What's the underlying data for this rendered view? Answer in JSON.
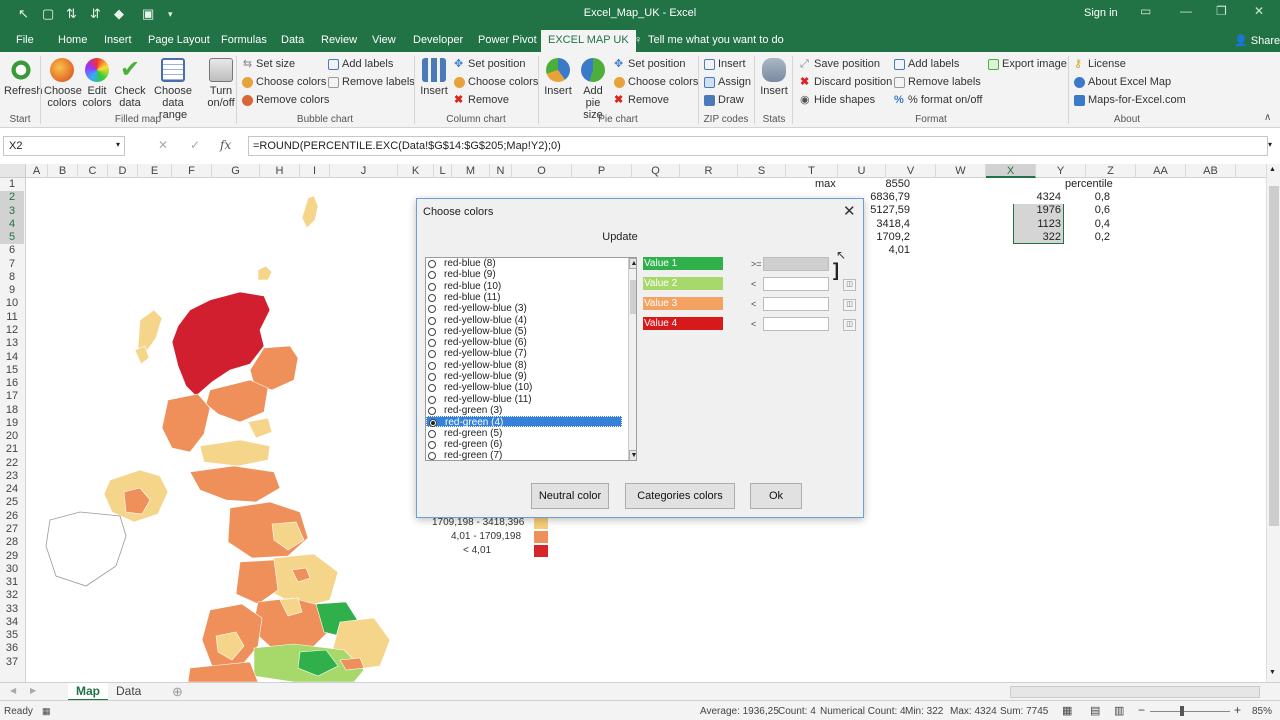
{
  "window": {
    "title": "Excel_Map_UK - Excel",
    "signin": "Sign in",
    "share": "Share"
  },
  "tabs": [
    "File",
    "Home",
    "Insert",
    "Page Layout",
    "Formulas",
    "Data",
    "Review",
    "View",
    "Developer",
    "Power Pivot",
    "EXCEL MAP UK",
    "Tell me what you want to do"
  ],
  "ribbon": {
    "refresh": "Refresh",
    "choose_colors_big": "Choose colors",
    "edit_colors": "Edit colors",
    "check_data": "Check data",
    "choose_data_range": "Choose data range",
    "turn_onoff": "Turn on/off",
    "bubble_set_size": "Set size",
    "bubble_choose_colors": "Choose colors",
    "bubble_remove_colors": "Remove colors",
    "bubble_add_labels": "Add labels",
    "bubble_remove_labels": "Remove labels",
    "column_insert": "Insert",
    "column_set_position": "Set position",
    "column_choose_colors": "Choose colors",
    "column_remove": "Remove",
    "pie_insert": "Insert",
    "pie_add_size": "Add pie size",
    "pie_set_position": "Set position",
    "pie_choose_colors": "Choose colors",
    "pie_remove": "Remove",
    "zip_insert": "Insert",
    "zip_assign": "Assign",
    "zip_draw": "Draw",
    "stats_insert": "Insert",
    "save_position": "Save position",
    "discard_position": "Discard position",
    "hide_shapes": "Hide shapes",
    "add_labels": "Add labels",
    "remove_labels": "Remove labels",
    "percent_format": "% format on/off",
    "export_image": "Export image",
    "license": "License",
    "about": "About Excel Map",
    "maps_site": "Maps-for-Excel.com",
    "groups": [
      "Start",
      "Filled map",
      "Bubble chart",
      "Column chart",
      "Pie chart",
      "ZIP codes",
      "Stats",
      "Format",
      "About"
    ]
  },
  "formula_bar": {
    "name_box": "X2",
    "formula": "=ROUND(PERCENTILE.EXC(Data!$G$14:$G$205;Map!Y2);0)"
  },
  "columns": [
    "A",
    "B",
    "C",
    "D",
    "E",
    "F",
    "G",
    "H",
    "I",
    "J",
    "K",
    "L",
    "M",
    "N",
    "O",
    "P",
    "Q",
    "R",
    "S",
    "T",
    "U",
    "V",
    "W",
    "X",
    "Y",
    "Z",
    "AA",
    "AB"
  ],
  "rows": [
    "1",
    "2",
    "3",
    "4",
    "5",
    "6",
    "7",
    "8",
    "9",
    "10",
    "11",
    "12",
    "13",
    "14",
    "15",
    "16",
    "17",
    "18",
    "19",
    "20",
    "21",
    "22",
    "23",
    "24",
    "25",
    "26",
    "27",
    "28",
    "29",
    "30",
    "31",
    "32",
    "33",
    "34",
    "35",
    "36",
    "37"
  ],
  "cells": {
    "t1": "max",
    "u1": "8550",
    "u2": "6836,79",
    "u3": "5127,59",
    "u4": "3418,4",
    "u5": "1709,2",
    "u6": "4,01",
    "x2": "4324",
    "x3": "1976",
    "x4": "1123",
    "x5": "322",
    "y1": "percentile",
    "y2": "0,8",
    "y3": "0,6",
    "y4": "0,4",
    "y5": "0,2"
  },
  "legend": [
    {
      "label": "1709,198  -  3418,396",
      "color": "#f5cf7a"
    },
    {
      "label": "4,01  -  1709,198",
      "color": "#ef8f5a"
    },
    {
      "label": "<    4,01",
      "color": "#d7262b"
    }
  ],
  "dialog": {
    "title": "Choose colors",
    "update": "Update",
    "schemes": [
      "red-blue (8)",
      "red-blue (9)",
      "red-blue (10)",
      "red-blue (11)",
      "red-yellow-blue (3)",
      "red-yellow-blue (4)",
      "red-yellow-blue (5)",
      "red-yellow-blue (6)",
      "red-yellow-blue (7)",
      "red-yellow-blue (8)",
      "red-yellow-blue (9)",
      "red-yellow-blue (10)",
      "red-yellow-blue (11)",
      "red-green (3)",
      "red-green (4)",
      "red-green (5)",
      "red-green (6)",
      "red-green (7)"
    ],
    "selected_index": 14,
    "values": [
      {
        "label": "Value 1",
        "color": "#2fb04a",
        "op": ">="
      },
      {
        "label": "Value 2",
        "color": "#a6d96a",
        "op": "<"
      },
      {
        "label": "Value 3",
        "color": "#f4a261",
        "op": "<"
      },
      {
        "label": "Value 4",
        "color": "#d7191c",
        "op": "<"
      }
    ],
    "buttons": {
      "neutral": "Neutral color",
      "categories": "Categories colors",
      "ok": "Ok"
    }
  },
  "sheets": [
    "Map",
    "Data"
  ],
  "status": {
    "ready": "Ready",
    "average": "Average: 1936,25",
    "count": "Count: 4",
    "numerical_count": "Numerical Count: 4",
    "min": "Min: 322",
    "max": "Max: 4324",
    "sum": "Sum: 7745",
    "zoom": "85%"
  }
}
